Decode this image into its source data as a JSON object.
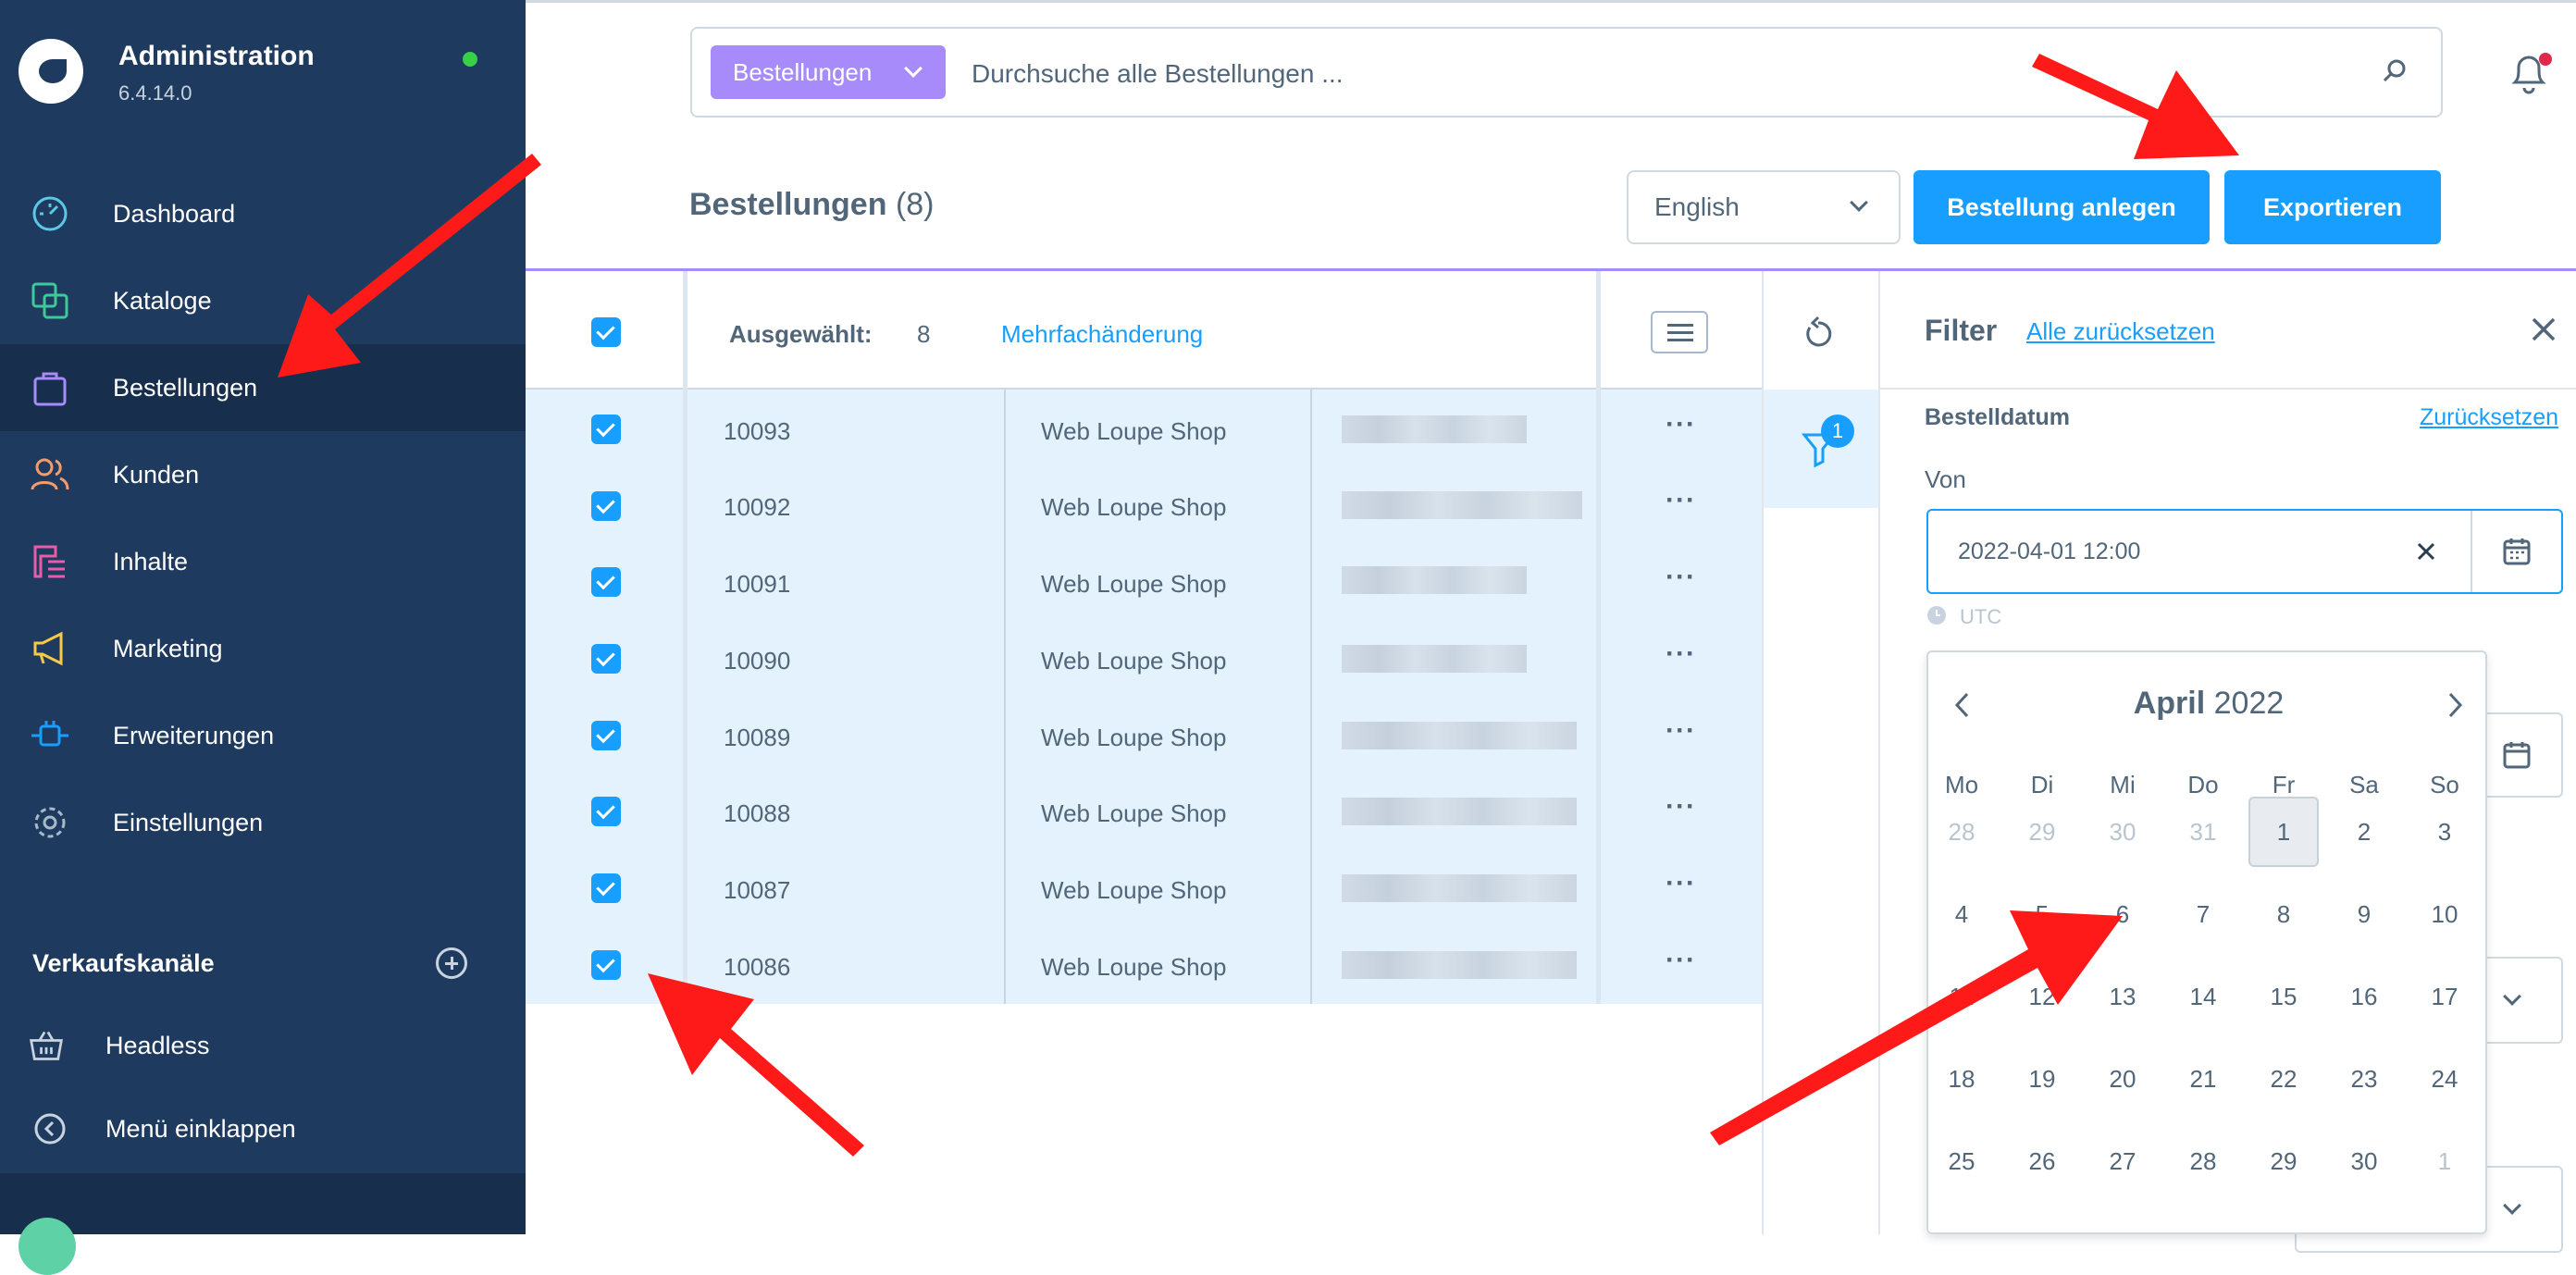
{
  "sidebar": {
    "app_title": "Administration",
    "version": "6.4.14.0",
    "items": [
      {
        "label": "Dashboard",
        "icon": "gauge-icon"
      },
      {
        "label": "Kataloge",
        "icon": "catalog-icon"
      },
      {
        "label": "Bestellungen",
        "icon": "shopping-bag-icon"
      },
      {
        "label": "Kunden",
        "icon": "users-icon"
      },
      {
        "label": "Inhalte",
        "icon": "content-icon"
      },
      {
        "label": "Marketing",
        "icon": "megaphone-icon"
      },
      {
        "label": "Erweiterungen",
        "icon": "plug-icon"
      },
      {
        "label": "Einstellungen",
        "icon": "gear-icon"
      }
    ],
    "sales_channels_title": "Verkaufskanäle",
    "sales_channels": [
      {
        "label": "Headless",
        "icon": "basket-icon"
      }
    ],
    "collapse_label": "Menü einklappen",
    "colors": {
      "bg": "#1e3a5f",
      "active": "#172e4d"
    }
  },
  "search": {
    "type_label": "Bestellungen",
    "placeholder": "Durchsuche alle Bestellungen ..."
  },
  "header": {
    "title": "Bestellungen",
    "count": "(8)",
    "language": "English",
    "create_button": "Bestellung anlegen",
    "export_button": "Exportieren",
    "accent": "#189eff"
  },
  "table": {
    "selected_label": "Ausgewählt:",
    "selected_count": "8",
    "bulk_edit": "Mehrfachänderung",
    "rows": [
      {
        "order": "10093",
        "channel": "Web Loupe Shop"
      },
      {
        "order": "10092",
        "channel": "Web Loupe Shop"
      },
      {
        "order": "10091",
        "channel": "Web Loupe Shop"
      },
      {
        "order": "10090",
        "channel": "Web Loupe Shop"
      },
      {
        "order": "10089",
        "channel": "Web Loupe Shop"
      },
      {
        "order": "10088",
        "channel": "Web Loupe Shop"
      },
      {
        "order": "10087",
        "channel": "Web Loupe Shop"
      },
      {
        "order": "10086",
        "channel": "Web Loupe Shop"
      }
    ],
    "more_label": "···"
  },
  "filter": {
    "title": "Filter",
    "reset_all": "Alle zurücksetzen",
    "active_count": "1",
    "section_title": "Bestelldatum",
    "section_reset": "Zurücksetzen",
    "from_label": "Von",
    "from_value": "2022-04-01 12:00",
    "timezone": "UTC"
  },
  "calendar": {
    "month": "April",
    "year": "2022",
    "weekdays": [
      "Mo",
      "Di",
      "Mi",
      "Do",
      "Fr",
      "Sa",
      "So"
    ],
    "weeks": [
      [
        "28",
        "29",
        "30",
        "31",
        "1",
        "2",
        "3"
      ],
      [
        "4",
        "5",
        "6",
        "7",
        "8",
        "9",
        "10"
      ],
      [
        "11",
        "12",
        "13",
        "14",
        "15",
        "16",
        "17"
      ],
      [
        "18",
        "19",
        "20",
        "21",
        "22",
        "23",
        "24"
      ],
      [
        "25",
        "26",
        "27",
        "28",
        "29",
        "30",
        "1"
      ]
    ],
    "selected_day": "1"
  }
}
